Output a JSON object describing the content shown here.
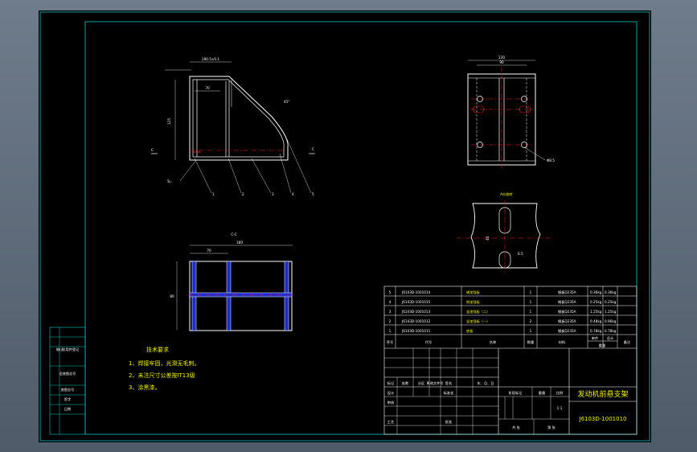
{
  "colors": {
    "background": "#5b6877",
    "sheet": "#000000",
    "frame": "#00c8c8",
    "outline": "#ffffff",
    "centerline": "#ff2020",
    "text_yellow": "#f3f000",
    "hidden": "#d01010"
  },
  "drawing": {
    "title": "发动机前悬支架",
    "drawing_number": "J6103D-1001010",
    "notes_title": "技术要求",
    "notes": [
      "1、焊接牢固，光滑无毛刺。",
      "2、未注尺寸公差按IT13级",
      "3、涂黑漆。"
    ],
    "section_label": "C-C",
    "section_marker": "C",
    "view_a_label": "A向旋转",
    "dim_front_width": "180.5±0.1",
    "dim_front_height": "125",
    "dim_front_inner": "70",
    "dim_angle": "45°",
    "dim_right_width": "130",
    "dim_right_inner": "90",
    "dim_hole": "Φ8.5",
    "dim_section_width": "180",
    "dim_section_inner": "70",
    "dim_section_height": "80",
    "dim_slot": "40",
    "dim_slot_width": "6.5",
    "weld_symbol": "5▷",
    "balloons": [
      "1",
      "2",
      "3",
      "4",
      "5"
    ]
  },
  "bom": {
    "rows": [
      {
        "no": "5",
        "code": "J6103D-1001014",
        "name": "横加强板",
        "qty": "1",
        "material": "钢板Q235A",
        "unit": "0.36kg",
        "total": "0.36kg",
        "note": ""
      },
      {
        "no": "4",
        "code": "J6103D-1001015",
        "name": "侧加强板",
        "qty": "1",
        "material": "钢板Q235A",
        "unit": "0.25kg",
        "total": "0.25kg",
        "note": ""
      },
      {
        "no": "3",
        "code": "J6103D-1001013",
        "name": "竖加强板（二）",
        "qty": "1",
        "material": "钢板Q235A",
        "unit": "1.25kg",
        "total": "1.25kg",
        "note": ""
      },
      {
        "no": "2",
        "code": "J6103D-1001012",
        "name": "竖加强板（一）",
        "qty": "2",
        "material": "钢板Q235A",
        "unit": "0.48kg",
        "total": "0.96kg",
        "note": ""
      },
      {
        "no": "1",
        "code": "J6103D-1001011",
        "name": "底板",
        "qty": "1",
        "material": "钢板Q235A",
        "unit": "0.78kg",
        "total": "0.78kg",
        "note": ""
      }
    ],
    "headers": [
      "序号",
      "代号",
      "名称",
      "数量",
      "材料",
      "单件",
      "总计",
      "备注"
    ],
    "weight_label": "重量"
  },
  "titleblock": {
    "labels": [
      "标记",
      "处数",
      "分区",
      "更改文件号",
      "签名",
      "年、月、日"
    ],
    "roles": [
      "设计",
      "审核",
      "工艺",
      "标准化",
      "批准"
    ],
    "stage_label": "阶段标记",
    "weight_label": "重量",
    "scale_label": "比例",
    "weight_value": "",
    "scale_value": "1:1",
    "sheets_label": "共 张",
    "sheet_label": "第 张"
  },
  "left_panel": {
    "rows": [
      "借(通)用件登记",
      "旧底图总号",
      "底图总号",
      "签字",
      "日期"
    ]
  }
}
